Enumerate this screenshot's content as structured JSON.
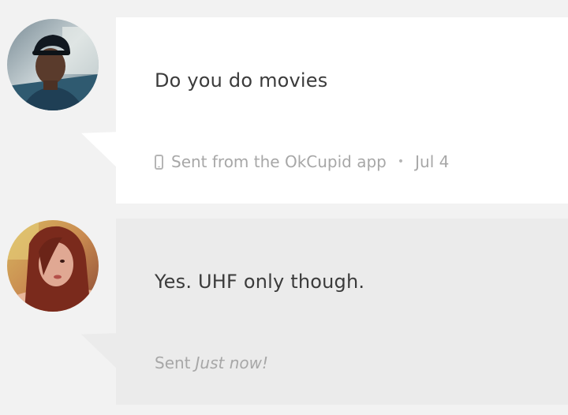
{
  "messages": [
    {
      "body": "Do you do movies",
      "meta": {
        "source": "Sent from the OkCupid app",
        "separator": "•",
        "date": "Jul 4"
      },
      "icons": {
        "device": "phone-icon"
      },
      "bubble_color": "#ffffff"
    },
    {
      "body": "Yes. UHF only though.",
      "meta": {
        "sent_label": "Sent",
        "sent_time": "Just now!"
      },
      "bubble_color": "#ebebeb"
    }
  ],
  "colors": {
    "background": "#f2f2f2",
    "text": "#3b3b3b",
    "meta_text": "#a7a7a7"
  }
}
